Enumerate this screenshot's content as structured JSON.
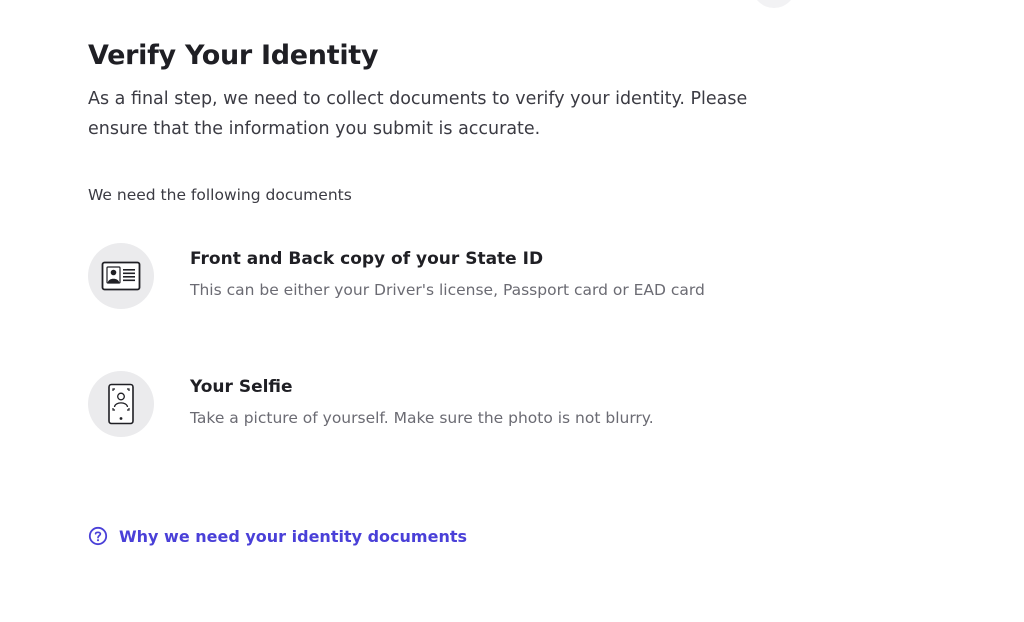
{
  "header": {
    "title": "Verify Your Identity",
    "intro": "As a final step, we need to collect documents to verify your identity. Please ensure that the information you submit is accurate."
  },
  "documents": {
    "heading": "We need the following documents",
    "items": [
      {
        "icon": "id-card-icon",
        "title": "Front and Back copy of your State ID",
        "description": "This can be either your Driver's license, Passport card or EAD card"
      },
      {
        "icon": "selfie-phone-icon",
        "title": "Your Selfie",
        "description": "Take a picture of yourself. Make sure the photo is not blurry."
      }
    ]
  },
  "help": {
    "icon": "question-circle-icon",
    "link_label": "Why we need your identity documents"
  },
  "colors": {
    "link": "#4a40d8",
    "icon_bg": "#ebebed",
    "text_primary": "#1f1f24",
    "text_secondary": "#6b6b73"
  }
}
